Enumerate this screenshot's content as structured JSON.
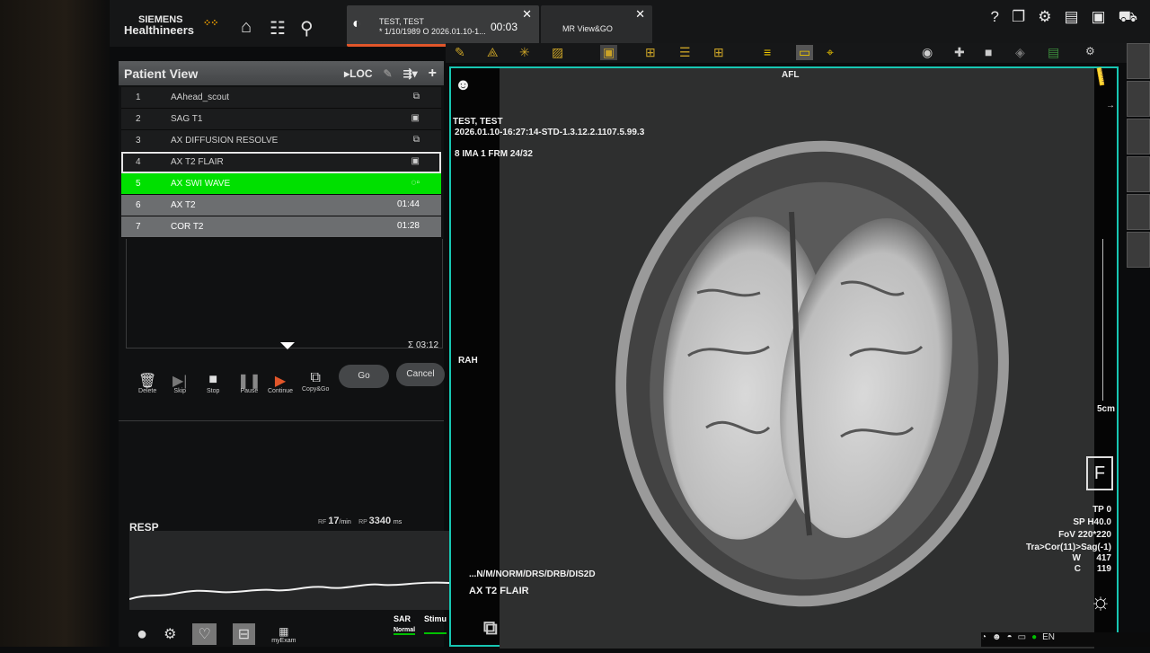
{
  "brand": {
    "line1": "SIEMENS",
    "line2": "Healthineers"
  },
  "tabs": [
    {
      "line1": "TEST, TEST",
      "line2": "* 1/10/1989 O 2026.01.10-1...",
      "time": "00:03"
    },
    {
      "label": "MR View&GO"
    }
  ],
  "patient_view": {
    "title": "Patient View",
    "loc_label": "LOC",
    "rows": [
      {
        "num": "1",
        "name": "AAhead_scout",
        "right": ""
      },
      {
        "num": "2",
        "name": "SAG T1",
        "right": ""
      },
      {
        "num": "3",
        "name": "AX DIFFUSION RESOLVE",
        "right": ""
      },
      {
        "num": "4",
        "name": "AX T2 FLAIR",
        "right": ""
      },
      {
        "num": "5",
        "name": "AX SWI WAVE",
        "right": ""
      },
      {
        "num": "6",
        "name": "AX T2",
        "right": "01:44"
      },
      {
        "num": "7",
        "name": "COR T2",
        "right": "01:28"
      }
    ],
    "total": "Σ 03:12"
  },
  "controls": {
    "delete": "Delete",
    "skip": "Skip",
    "stop": "Stop",
    "pause": "Pause",
    "continue": "Continue",
    "copy_go": "Copy&Go",
    "go": "Go",
    "cancel": "Cancel"
  },
  "resp": {
    "label": "RESP",
    "rate": "17",
    "rate_unit": "/min",
    "period": "3340",
    "period_unit": "ms"
  },
  "status": {
    "sar": "SAR",
    "sar_state": "Normal",
    "stimu": "Stimu",
    "myexam": "myExam"
  },
  "viewer": {
    "orient_top": "AFL",
    "orient_left": "RAH",
    "patient": "TEST, TEST",
    "study": "2026.01.10-16:27:14-STD-1.3.12.2.1107.5.99.3",
    "frame": "8 IMA 1 FRM 24/32",
    "seq_path": "...N/M/NORM/DRS/DRB/DIS2D",
    "seq_name": "AX T2 FLAIR",
    "scale_label": "5cm",
    "tp": "TP 0",
    "sp": "SP H40.0",
    "fov": "FoV 220*220",
    "tra": "Tra>Cor(11)>Sag(-1)",
    "w_label": "W",
    "w_val": "417",
    "c_label": "C",
    "c_val": "119",
    "f_marker": "F"
  },
  "tray": {
    "lang": "EN"
  }
}
